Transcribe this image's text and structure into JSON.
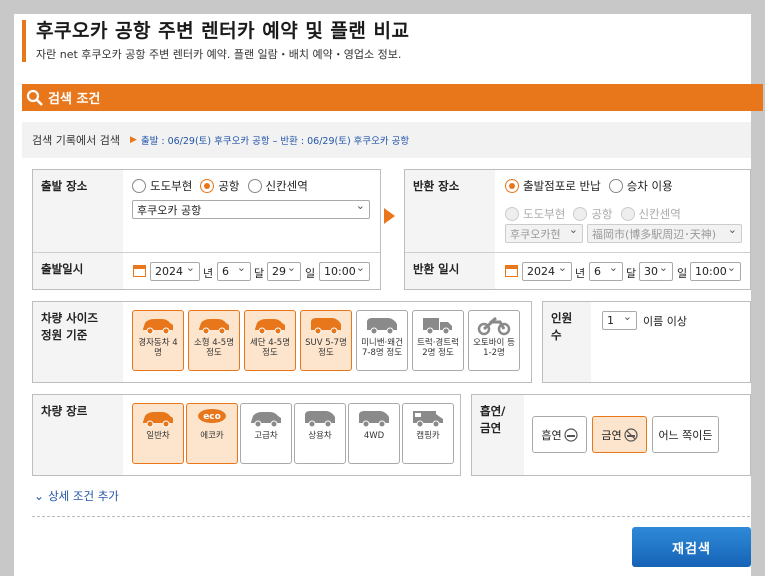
{
  "header": {
    "title": "후쿠오카 공항 주변 렌터카 예약 및 플랜 비교",
    "subtitle": "자란 net 후쿠오카 공항 주변 렌터카 예약. 플랜 일람・배치 예약・영업소 정보."
  },
  "search": {
    "section_title": "검색 조건",
    "history_label": "검색 기록에서 검색",
    "history_link": "출발 : 06/29(토) 후쿠오카 공항 – 반환 : 06/29(토) 후쿠오카 공항"
  },
  "departure": {
    "place_label": "출발 장소",
    "options": [
      "도도부현",
      "공항",
      "신칸센역"
    ],
    "selected": "공항",
    "place_value": "후쿠오카 공항",
    "datetime_label": "출발일시",
    "year": "2024",
    "year_unit": "년",
    "month": "6",
    "month_unit": "달",
    "day": "29",
    "day_unit": "일",
    "time": "10:00"
  },
  "return": {
    "place_label": "반환 장소",
    "options": [
      "출발점포로 반납",
      "승차 이용"
    ],
    "selected": "출발점포로 반납",
    "sub_options": [
      "도도부현",
      "공항",
      "신칸센역"
    ],
    "pref_value": "후쿠오카현",
    "area_value": "福岡市(博多駅周辺･天神)",
    "datetime_label": "반환 일시",
    "year": "2024",
    "year_unit": "년",
    "month": "6",
    "month_unit": "달",
    "day": "30",
    "day_unit": "일",
    "time": "10:00"
  },
  "vehicle_size": {
    "label_line1": "차량 사이즈",
    "label_line2": "정원 기준",
    "items": [
      {
        "label": "경자동차 4명",
        "selected": true
      },
      {
        "label": "소형 4-5명 정도",
        "selected": true
      },
      {
        "label": "세단 4-5명 정도",
        "selected": true
      },
      {
        "label": "SUV 5-7명 정도",
        "selected": true
      },
      {
        "label": "미니밴·왜건 7-8명 정도",
        "selected": false
      },
      {
        "label": "트럭·경트럭 2명 정도",
        "selected": false
      },
      {
        "label": "오토바이 등 1-2명",
        "selected": false
      }
    ]
  },
  "passengers": {
    "label_line1": "인원",
    "label_line2": "수",
    "value": "1",
    "suffix": "이름 이상"
  },
  "vehicle_type": {
    "label": "차량 장르",
    "items": [
      {
        "label": "일반차",
        "selected": true
      },
      {
        "label": "에코카",
        "selected": true
      },
      {
        "label": "고급차",
        "selected": false
      },
      {
        "label": "상용차",
        "selected": false
      },
      {
        "label": "4WD",
        "selected": false
      },
      {
        "label": "캠핑카",
        "selected": false
      }
    ]
  },
  "smoking": {
    "label_line1": "흡연/",
    "label_line2": "금연",
    "smoking": "흡연",
    "non_smoking": "금연",
    "either": "어느 쪽이든"
  },
  "more_conditions": "상세 조건 추가",
  "research_button": "재검색",
  "colors": {
    "accent": "#e8771c",
    "primary_button": "#1d6fc4",
    "selected_tile": "#fde4cc"
  }
}
